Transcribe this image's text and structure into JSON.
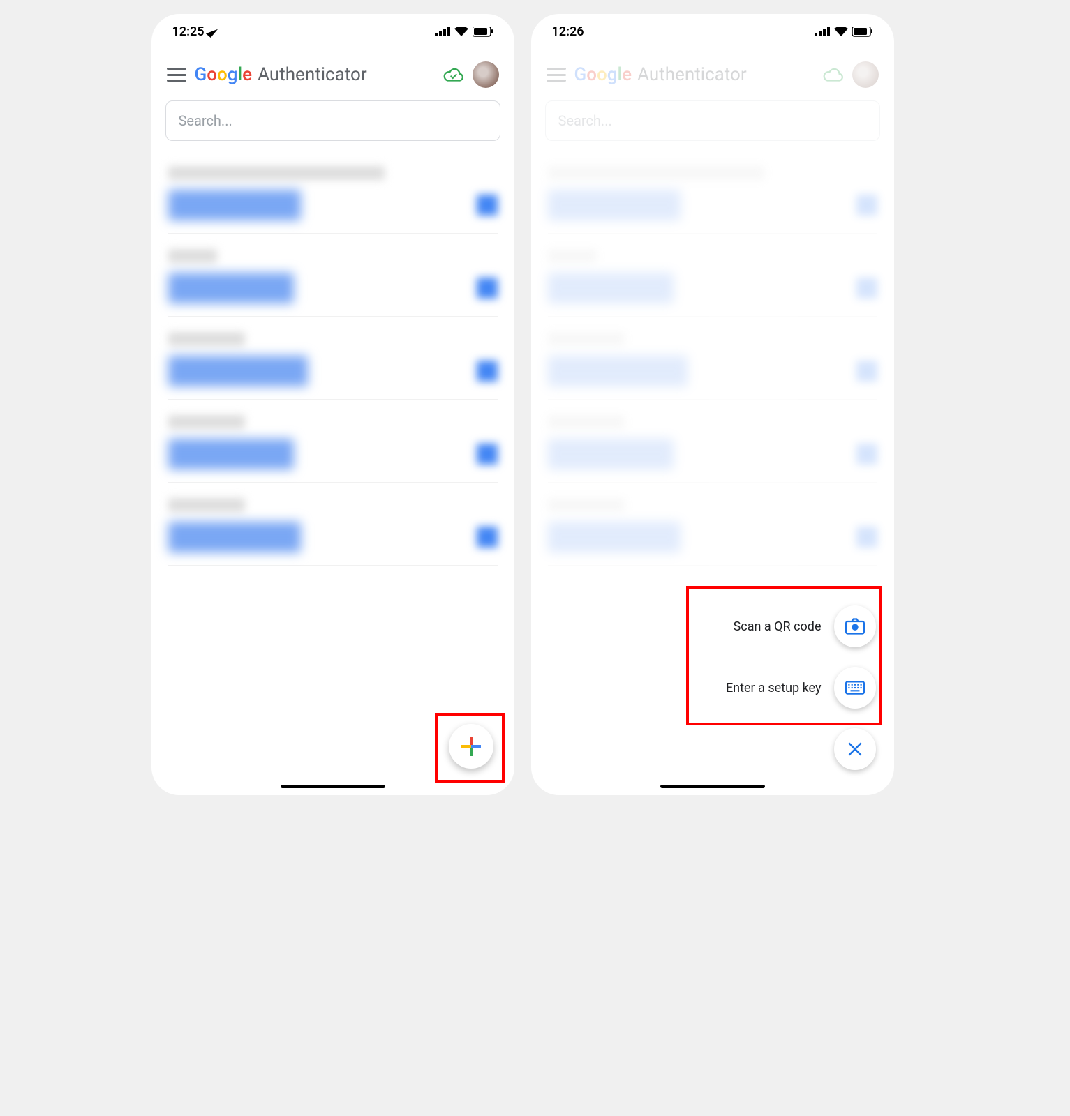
{
  "screen1": {
    "status": {
      "time": "12:25"
    },
    "header": {
      "brand": "Google",
      "title": "Authenticator"
    },
    "search": {
      "placeholder": "Search..."
    },
    "accounts": [
      {
        "label_w": 310,
        "code_w": 190
      },
      {
        "label_w": 70,
        "code_w": 180
      },
      {
        "label_w": 110,
        "code_w": 200
      },
      {
        "label_w": 110,
        "code_w": 180
      },
      {
        "label_w": 110,
        "code_w": 190
      }
    ]
  },
  "screen2": {
    "status": {
      "time": "12:26"
    },
    "header": {
      "brand": "Google",
      "title": "Authenticator"
    },
    "search": {
      "placeholder": "Search..."
    },
    "fab_menu": {
      "scan_label": "Scan a QR code",
      "setup_label": "Enter a setup key"
    }
  }
}
